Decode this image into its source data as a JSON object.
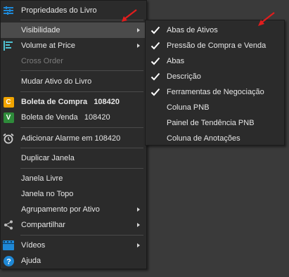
{
  "menu": {
    "items": [
      {
        "label": "Propriedades do Livro",
        "icon": "sliders-icon"
      },
      {
        "label": "Visibilidade",
        "submenu": true
      },
      {
        "label": "Volume at Price",
        "icon": "volume-at-price-icon",
        "submenu": true
      },
      {
        "label": "Cross Order",
        "disabled": true
      },
      {
        "label": "Mudar Ativo do Livro"
      },
      {
        "label": "Boleta de Compra",
        "value": "108420",
        "badge": "C",
        "badge_color": "#f0a400"
      },
      {
        "label": "Boleta de Venda",
        "value": "108420",
        "badge": "V",
        "badge_color": "#2e8b3a"
      },
      {
        "label": "Adicionar Alarme em 108420",
        "icon": "alarm-clock-icon"
      },
      {
        "label": "Duplicar Janela"
      },
      {
        "label": "Janela Livre"
      },
      {
        "label": "Janela no Topo"
      },
      {
        "label": "Agrupamento por Ativo",
        "submenu": true
      },
      {
        "label": "Compartilhar",
        "icon": "share-icon",
        "submenu": true
      },
      {
        "label": "Vídeos",
        "icon": "video-icon",
        "submenu": true
      },
      {
        "label": "Ajuda",
        "icon": "help-icon"
      }
    ]
  },
  "submenu": {
    "items": [
      {
        "label": "Abas de Ativos",
        "checked": true
      },
      {
        "label": "Pressão de Compra e Venda",
        "checked": true
      },
      {
        "label": "Abas",
        "checked": true
      },
      {
        "label": "Descrição",
        "checked": true
      },
      {
        "label": "Ferramentas de Negociação",
        "checked": true
      },
      {
        "label": "Coluna PNB",
        "checked": false
      },
      {
        "label": "Painel de Tendência PNB",
        "checked": false
      },
      {
        "label": "Coluna de Anotações",
        "checked": false
      }
    ]
  },
  "colors": {
    "menu_bg": "#2b2b2b",
    "highlight": "#4b4b4b",
    "accent_blue": "#1e88d6",
    "annotation_red": "#e11d1d"
  }
}
